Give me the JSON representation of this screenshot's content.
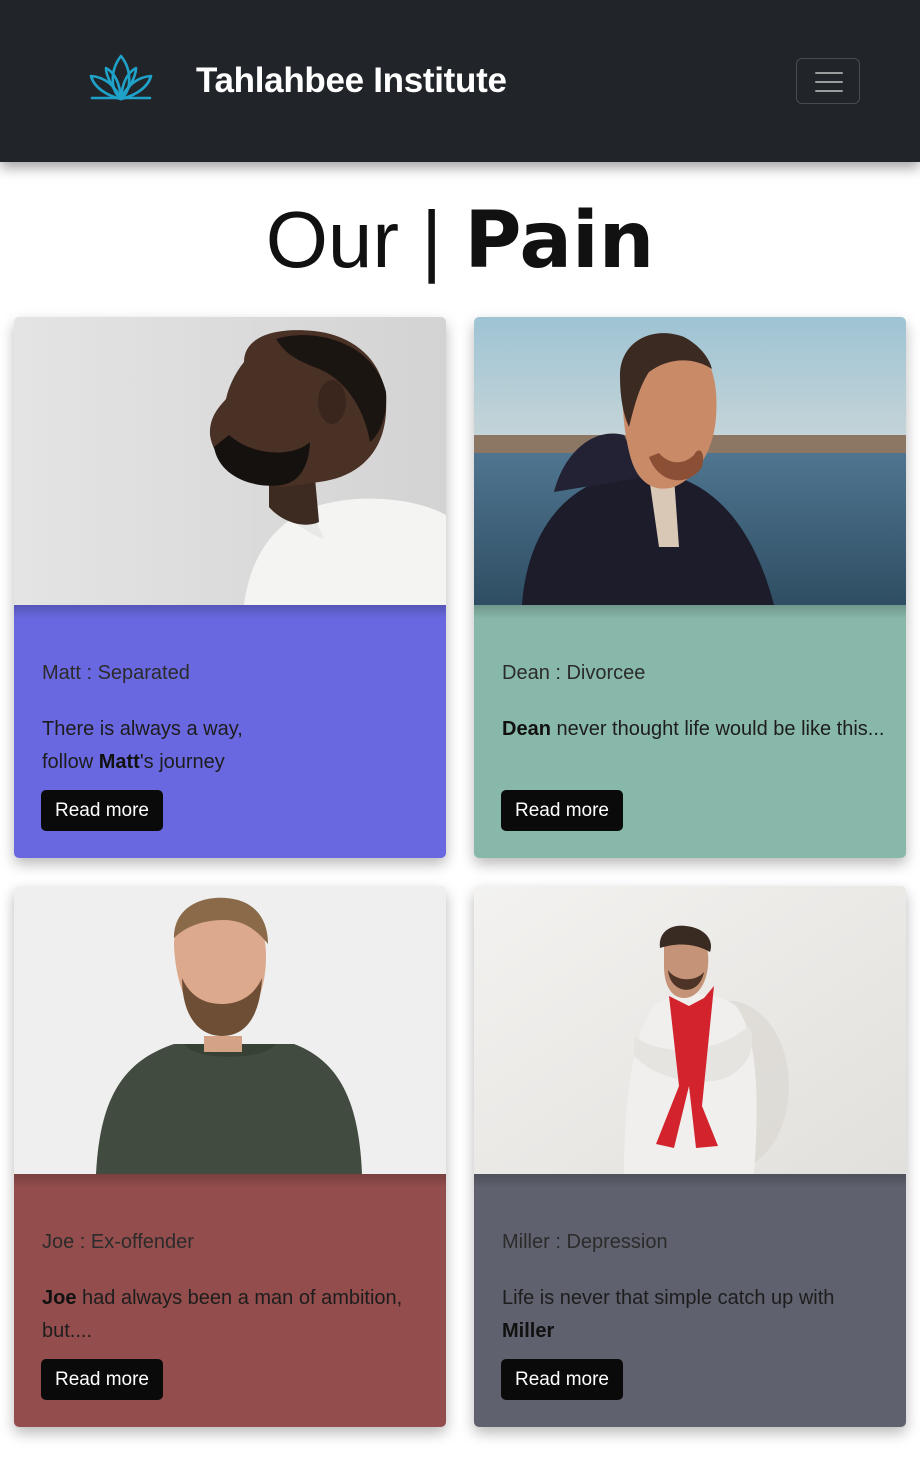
{
  "header": {
    "brand_name": "Tahlahbee Institute",
    "logo_icon": "lotus-icon",
    "menu_icon": "hamburger-menu-icon",
    "colors": {
      "background": "#212529",
      "logo": "#1fa2c9",
      "brand_text": "#ffffff"
    }
  },
  "page": {
    "title_light": "Our |",
    "title_bold": "Pain"
  },
  "cards": [
    {
      "subtitle": "Matt : Separated",
      "text_line1": "There is always a way,",
      "text_pre": "follow ",
      "text_bold": "Matt",
      "text_post": "'s journey",
      "button": "Read more",
      "color": "#6968e0"
    },
    {
      "subtitle": "Dean : Divorcee",
      "text_bold": "Dean",
      "text_post": " never thought life would be like this...",
      "button": "Read more",
      "color": "#88b8a9"
    },
    {
      "subtitle": "Joe : Ex-offender",
      "text_bold": "Joe",
      "text_post": " had always been a man of ambition, but....",
      "button": "Read more",
      "color": "#934d4c"
    },
    {
      "subtitle": "Miller : Depression",
      "text_pre": "Life is never that simple catch up with ",
      "text_bold": "Miller",
      "button": "Read more",
      "color": "#5f626e"
    }
  ]
}
